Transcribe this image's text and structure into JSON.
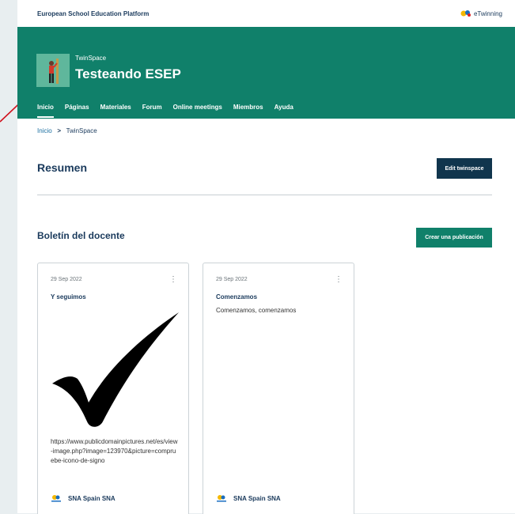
{
  "topbar": {
    "brand": "European School Education Platform",
    "etwinning": "eTwinning"
  },
  "hero": {
    "subtitle": "TwinSpace",
    "title": "Testeando ESEP"
  },
  "nav": {
    "items": [
      "Inicio",
      "Páginas",
      "Materiales",
      "Forum",
      "Online meetings",
      "Miembros",
      "Ayuda"
    ]
  },
  "breadcrumb": {
    "home": "Inicio",
    "sep": ">",
    "current": "TwinSpace"
  },
  "summary": {
    "heading": "Resumen",
    "edit_button": "Edit twinspace"
  },
  "bulletin": {
    "heading": "Boletín del docente",
    "create_button": "Crear una publicación"
  },
  "cards": [
    {
      "date": "29 Sep 2022",
      "menu": "⋮",
      "title": "Y seguimos",
      "body": "",
      "url": "https://www.publicdomainpictures.net/es/view-image.php?image=123970&picture=compruebe-icono-de-signo",
      "author": "SNA Spain SNA"
    },
    {
      "date": "29 Sep 2022",
      "menu": "⋮",
      "title": "Comenzamos",
      "body": "Comenzamos, comenzamos",
      "url": "",
      "author": "SNA Spain SNA"
    }
  ],
  "colors": {
    "hero": "#10806a",
    "dark_button": "#10354d",
    "arrow": "#d0101c"
  }
}
